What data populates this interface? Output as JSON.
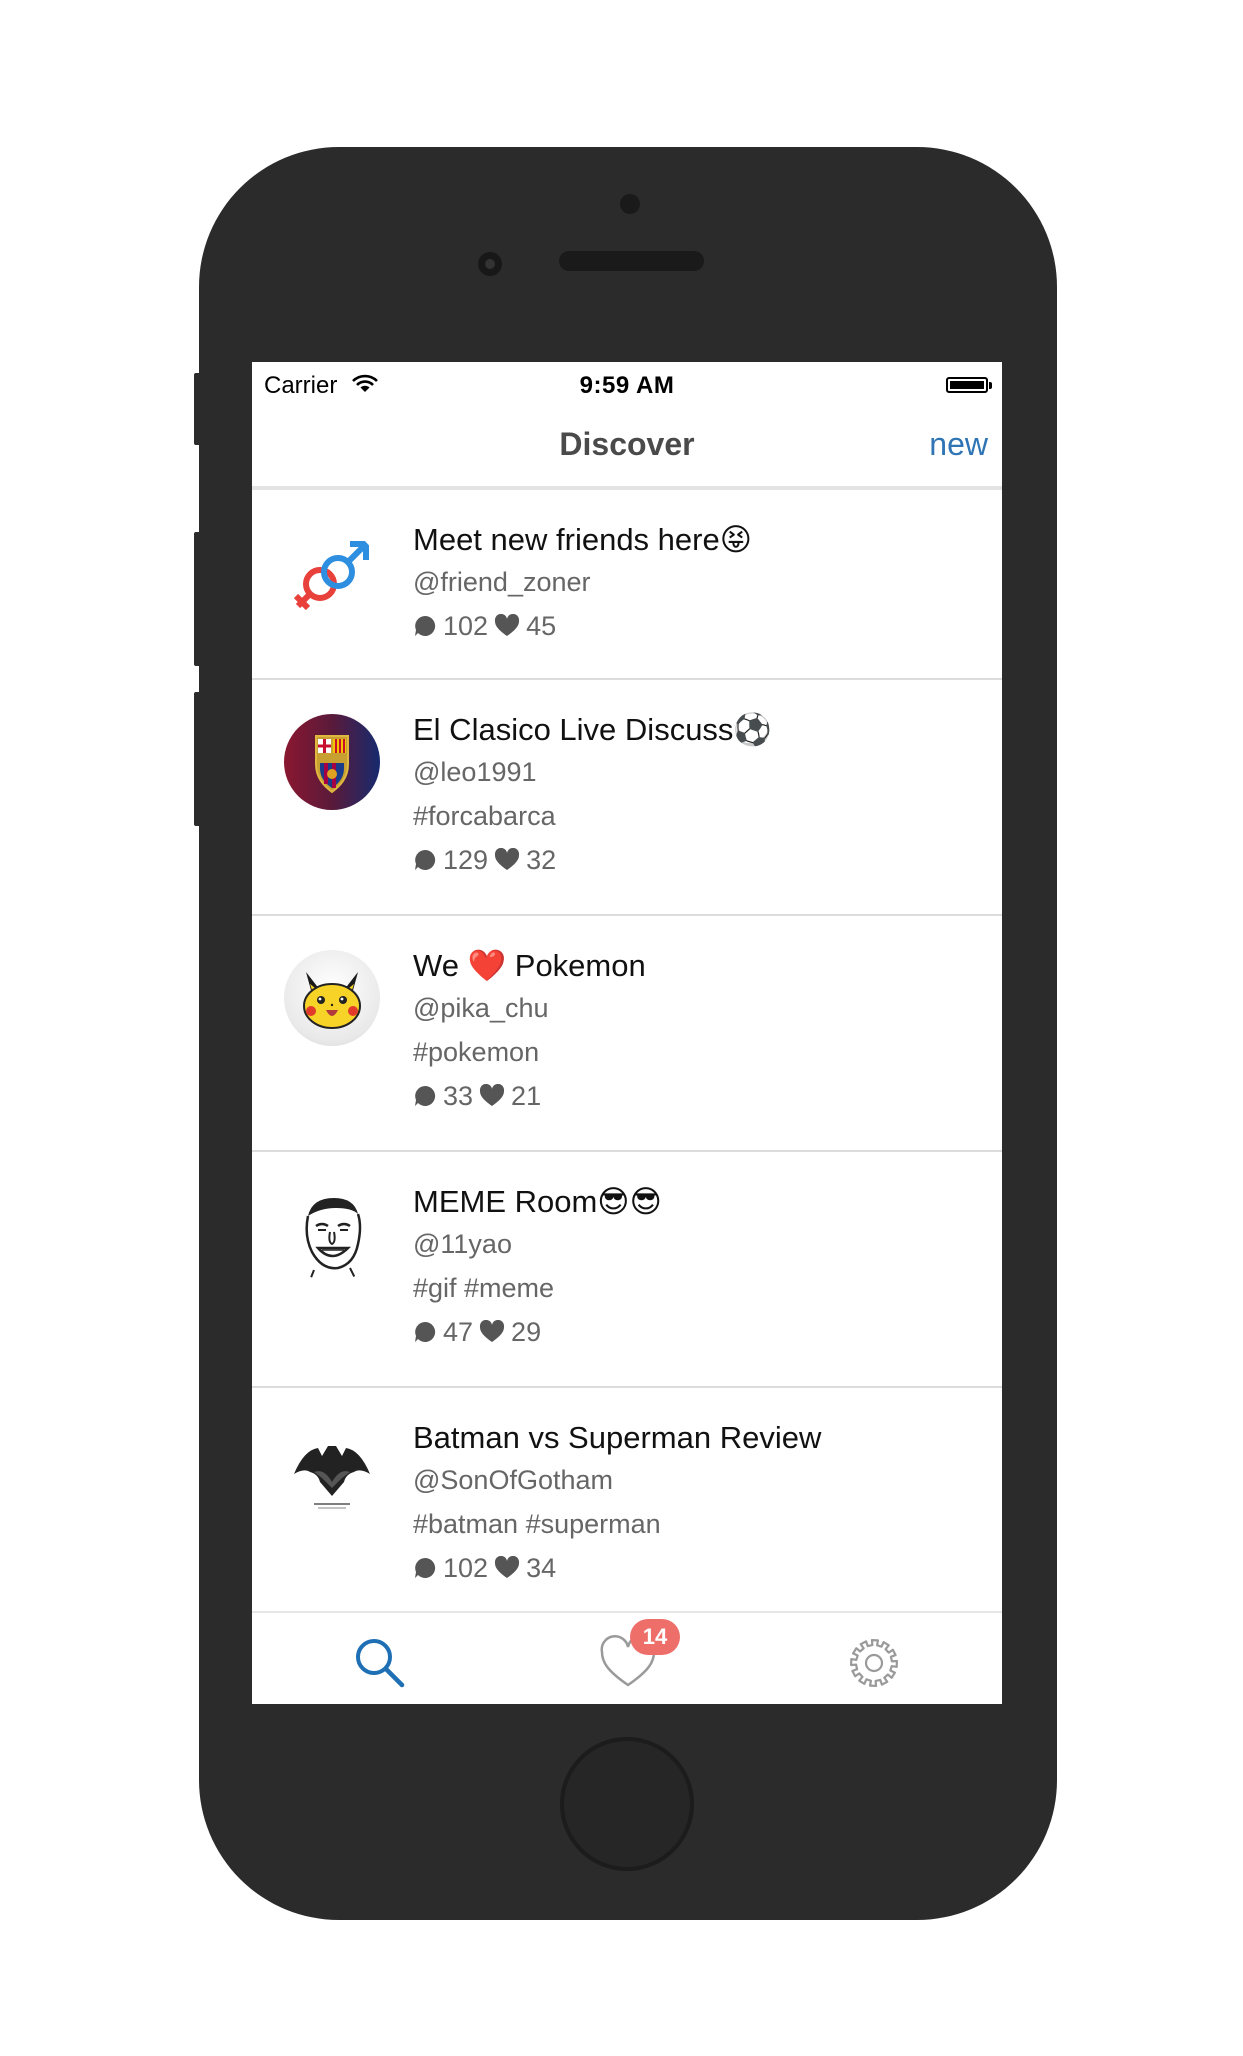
{
  "status_bar": {
    "carrier": "Carrier",
    "time": "9:59 AM"
  },
  "nav": {
    "title": "Discover",
    "new_label": "new"
  },
  "rooms": [
    {
      "title": "Meet new friends here😝",
      "user": "@friend_zoner",
      "tags": "",
      "comments": "102",
      "likes": "45",
      "avatar_icon": "gender-symbols-icon"
    },
    {
      "title": "El Clasico Live Discuss⚽",
      "user": "@leo1991",
      "tags": "#forcabarca",
      "comments": "129",
      "likes": "32",
      "avatar_icon": "fc-barcelona-crest-icon"
    },
    {
      "title": "We ❤️ Pokemon",
      "user": "@pika_chu",
      "tags": "#pokemon",
      "comments": "33",
      "likes": "21",
      "avatar_icon": "pikachu-icon"
    },
    {
      "title": "MEME Room😎😎",
      "user": "@11yao",
      "tags": "#gif #meme",
      "comments": "47",
      "likes": "29",
      "avatar_icon": "yao-ming-meme-face-icon"
    },
    {
      "title": "Batman vs Superman Review",
      "user": "@SonOfGotham",
      "tags": "#batman #superman",
      "comments": "102",
      "likes": "34",
      "avatar_icon": "batman-v-superman-logo-icon"
    }
  ],
  "tab_bar": {
    "badge": "14",
    "tabs": [
      "search-icon",
      "heart-icon",
      "gear-icon"
    ],
    "active_color": "#1f6fb5",
    "inactive_color": "#9a9a9a"
  },
  "colors": {
    "accent": "#2f75b5",
    "badge": "#ee6f6a",
    "device": "#2b2b2b"
  }
}
